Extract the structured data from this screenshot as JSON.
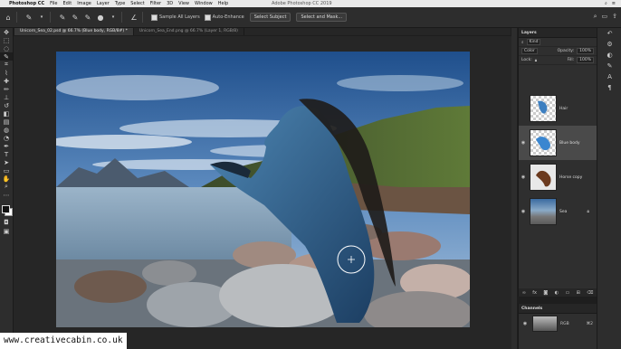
{
  "mac_menu": {
    "app_name": "Photoshop CC",
    "items": [
      "File",
      "Edit",
      "Image",
      "Layer",
      "Type",
      "Select",
      "Filter",
      "3D",
      "View",
      "Window",
      "Help"
    ],
    "window_title": "Adobe Photoshop CC 2019"
  },
  "options_bar": {
    "sample_all_layers": "Sample All Layers",
    "auto_enhance": "Auto-Enhance",
    "select_subject": "Select Subject",
    "select_and_mask": "Select and Mask..."
  },
  "doc_tabs": [
    {
      "label": "Unicorn_Sea_02.psd @ 66.7% (Blue body, RGB/8#) *",
      "active": true
    },
    {
      "label": "Unicorn_Sea_End.png @ 66.7% (Layer 1, RGB/8)",
      "active": false
    }
  ],
  "layers_panel": {
    "title": "Layers",
    "kind_label": "Kind",
    "blend_mode": "Color",
    "opacity_label": "Opacity:",
    "opacity_value": "100%",
    "lock_label": "Lock:",
    "fill_label": "Fill:",
    "fill_value": "100%",
    "layers": [
      {
        "name": "Hair",
        "visible": false,
        "selected": false
      },
      {
        "name": "Blue body",
        "visible": true,
        "selected": true
      },
      {
        "name": "Horse copy",
        "visible": true,
        "selected": false
      },
      {
        "name": "Sea",
        "visible": true,
        "selected": false
      }
    ]
  },
  "channels_panel": {
    "title": "Channels",
    "rows": [
      {
        "name": "RGB",
        "shortcut": "⌘2"
      }
    ]
  },
  "watermark": "www.creativecabin.co.uk"
}
